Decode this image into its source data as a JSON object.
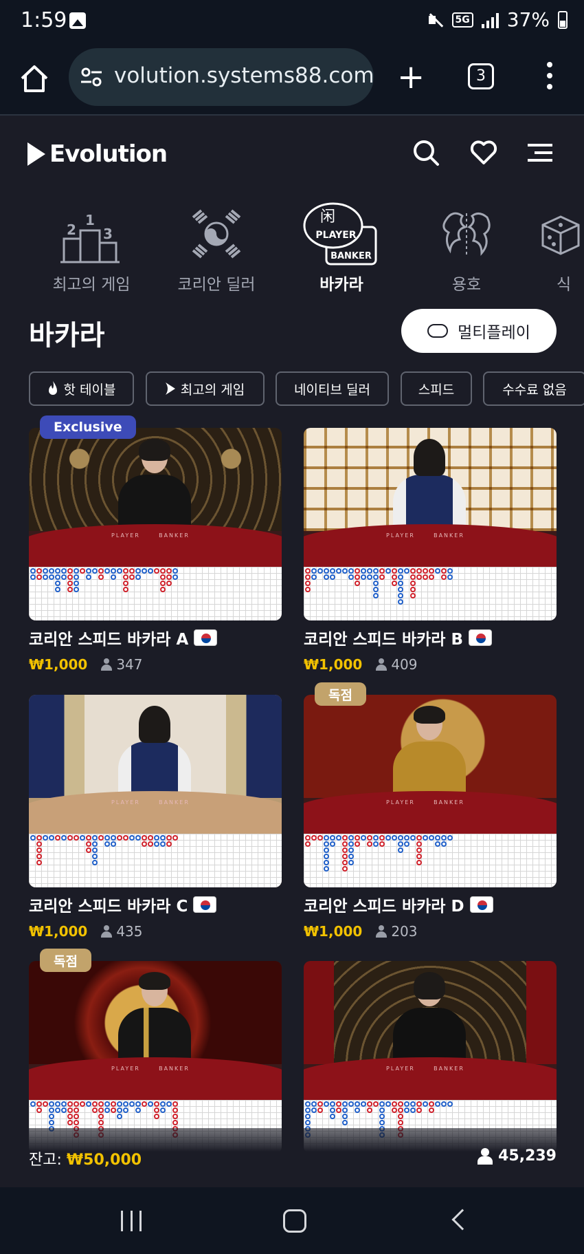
{
  "status_bar": {
    "time": "1:59",
    "network": "5G",
    "battery": "37%"
  },
  "browser": {
    "url": "volution.systems88.com",
    "tab_count": "3"
  },
  "header": {
    "brand": "Evolution"
  },
  "categories": [
    {
      "label": "최고의 게임",
      "icon": "podium-icon"
    },
    {
      "label": "코리안 딜러",
      "icon": "taegeuk-icon"
    },
    {
      "label": "바카라",
      "icon": "baccarat-icon",
      "active": true
    },
    {
      "label": "용호",
      "icon": "dragon-tiger-icon"
    },
    {
      "label": "식",
      "icon": "dice-icon"
    }
  ],
  "baccarat_icon_text": {
    "han": "闲",
    "player": "PLAYER",
    "banker": "BANKER"
  },
  "page": {
    "title": "바카라",
    "multiplay_label": "멀티플레이"
  },
  "chips": [
    {
      "label": "핫 테이블",
      "icon": "flame-icon"
    },
    {
      "label": "최고의 게임",
      "icon": "evolution-mark-icon"
    },
    {
      "label": "네이티브 딜러"
    },
    {
      "label": "스피드"
    },
    {
      "label": "수수료 없음"
    }
  ],
  "table_labels": {
    "player": "PLAYER",
    "banker": "BANKER"
  },
  "cards": [
    {
      "name": "코리안 스피드 바카라 A",
      "min_bet": "₩1,000",
      "players": "347",
      "badge": "Exclusive"
    },
    {
      "name": "코리안 스피드 바카라 B",
      "min_bet": "₩1,000",
      "players": "409",
      "badge": ""
    },
    {
      "name": "코리안 스피드 바카라 C",
      "min_bet": "₩1,000",
      "players": "435",
      "badge": ""
    },
    {
      "name": "코리안 스피드 바카라 D",
      "min_bet": "₩1,000",
      "players": "203",
      "badge": "독점"
    },
    {
      "name": "",
      "min_bet": "",
      "players": "",
      "badge": "독점"
    },
    {
      "name": "",
      "min_bet": "",
      "players": "",
      "badge": ""
    }
  ],
  "footer": {
    "balance_label": "잔고:",
    "balance_value": "₩50,000",
    "online_count": "45,239"
  },
  "colors": {
    "background": "#1b1c26",
    "accent_gold": "#f2c200",
    "exclusive_badge": "#3d4bb8",
    "dokjeom_badge": "#c2a36b",
    "banker_red": "#d0202a",
    "player_blue": "#1f5fc9"
  }
}
